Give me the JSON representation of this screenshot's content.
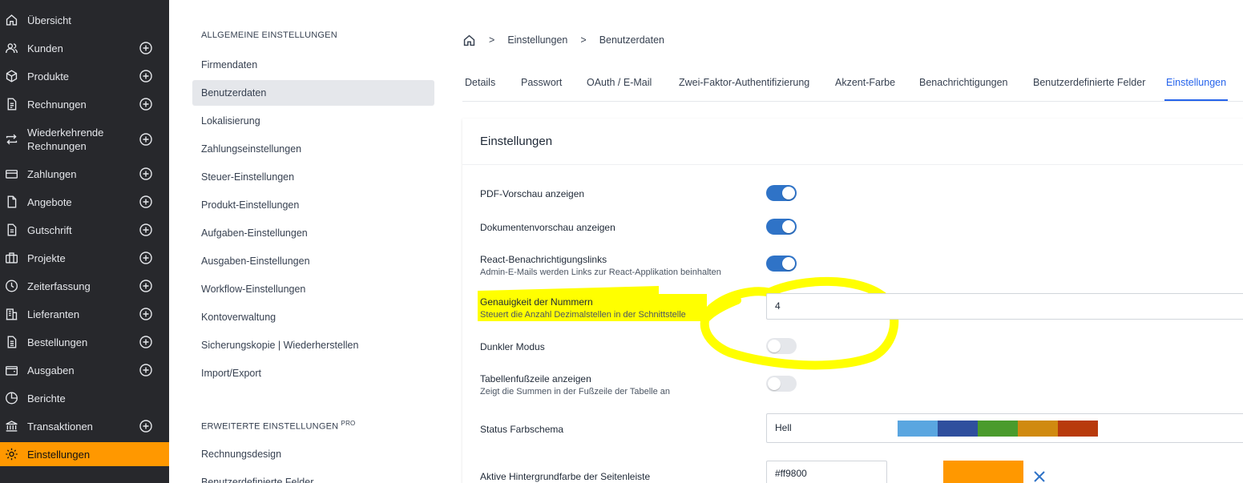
{
  "nav": {
    "items": [
      {
        "label": "Übersicht",
        "icon": "home-icon"
      },
      {
        "label": "Kunden",
        "icon": "users-icon"
      },
      {
        "label": "Produkte",
        "icon": "cube-icon"
      },
      {
        "label": "Rechnungen",
        "icon": "document-icon"
      },
      {
        "label": "Wiederkehrende Rechnungen",
        "icon": "repeat-icon"
      },
      {
        "label": "Zahlungen",
        "icon": "credit-card-icon"
      },
      {
        "label": "Angebote",
        "icon": "file-icon"
      },
      {
        "label": "Gutschrift",
        "icon": "file-text-icon"
      },
      {
        "label": "Projekte",
        "icon": "briefcase-icon"
      },
      {
        "label": "Zeiterfassung",
        "icon": "clock-icon"
      },
      {
        "label": "Lieferanten",
        "icon": "building-icon"
      },
      {
        "label": "Bestellungen",
        "icon": "clipboard-icon"
      },
      {
        "label": "Ausgaben",
        "icon": "wallet-icon"
      },
      {
        "label": "Berichte",
        "icon": "pie-chart-icon"
      },
      {
        "label": "Transaktionen",
        "icon": "bank-icon"
      },
      {
        "label": "Einstellungen",
        "icon": "gear-icon"
      }
    ],
    "active_color": "#ff9800"
  },
  "submenu": {
    "general_heading": "ALLGEMEINE EINSTELLUNGEN",
    "items": [
      "Firmendaten",
      "Benutzerdaten",
      "Lokalisierung",
      "Zahlungseinstellungen",
      "Steuer-Einstellungen",
      "Produkt-Einstellungen",
      "Aufgaben-Einstellungen",
      "Ausgaben-Einstellungen",
      "Workflow-Einstellungen",
      "Kontoverwaltung",
      "Sicherungskopie | Wiederherstellen",
      "Import/Export"
    ],
    "advanced_heading": "ERWEITERTE EINSTELLUNGEN",
    "advanced_badge": "PRO",
    "advanced_items": [
      "Rechnungsdesign",
      "Benutzerdefinierte Felder"
    ]
  },
  "breadcrumb": {
    "items": [
      "Einstellungen",
      "Benutzerdaten"
    ],
    "separator": ">"
  },
  "tabs": [
    "Details",
    "Passwort",
    "OAuth / E-Mail",
    "Zwei-Faktor-Authentifizierung",
    "Akzent-Farbe",
    "Benachrichtigungen",
    "Benutzerdefinierte Felder",
    "Einstellungen"
  ],
  "card": {
    "title": "Einstellungen",
    "pdf_preview": {
      "label": "PDF-Vorschau anzeigen",
      "on": true
    },
    "doc_preview": {
      "label": "Dokumentenvorschau anzeigen",
      "on": true
    },
    "react_links": {
      "label": "React-Benachrichtigungslinks",
      "sub": "Admin-E-Mails werden Links zur React-Applikation beinhalten",
      "on": true
    },
    "precision": {
      "label": "Genauigkeit der Nummern",
      "sub": "Steuert die Anzahl Dezimalstellen in der Schnittstelle",
      "value": "4"
    },
    "dark_mode": {
      "label": "Dunkler Modus",
      "on": false
    },
    "table_footer": {
      "label": "Tabellenfußzeile anzeigen",
      "sub": "Zeigt die Summen in der Fußzeile der Tabelle an",
      "on": false
    },
    "status_scheme": {
      "label": "Status Farbschema",
      "value": "Hell",
      "colors": [
        "#5aa6e0",
        "#2f4f9e",
        "#4a9b2c",
        "#d08a10",
        "#b83a0c"
      ]
    },
    "sidebar_bg": {
      "label": "Aktive Hintergrundfarbe der Seitenleiste",
      "value": "#ff9800",
      "swatch": "#ff9800"
    }
  },
  "colors": {
    "toggle_on": "#2f73c7",
    "tab_active": "#2563eb",
    "highlight": "#ffff00"
  }
}
